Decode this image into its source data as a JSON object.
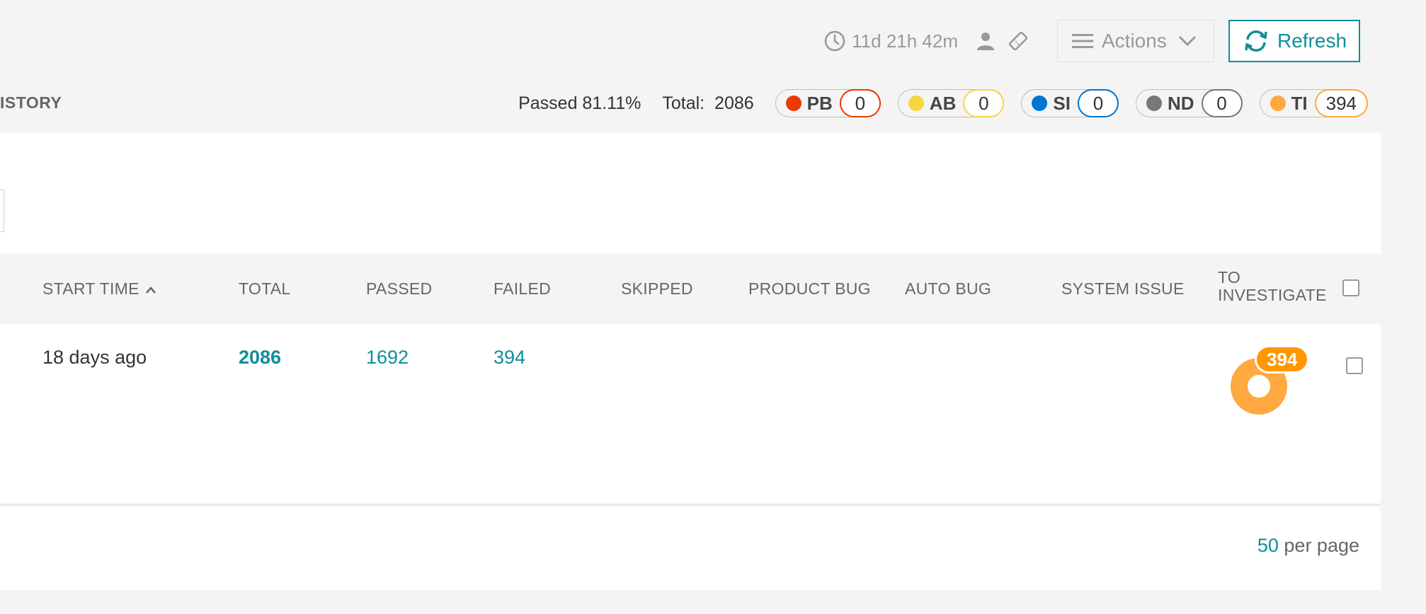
{
  "toolbar": {
    "duration": "11d 21h 42m",
    "actions_label": "Actions",
    "refresh_label": "Refresh"
  },
  "breadcrumb": {
    "partial_label": "ISTORY"
  },
  "statistics": {
    "passed": "Passed 81.11%",
    "total_label": "Total:",
    "total_value": "2086"
  },
  "defects": [
    {
      "abbr": "PB",
      "count": "0",
      "color": "#ec3900"
    },
    {
      "abbr": "AB",
      "count": "0",
      "color": "#f7d63e"
    },
    {
      "abbr": "SI",
      "count": "0",
      "color": "#0274d1"
    },
    {
      "abbr": "ND",
      "count": "0",
      "color": "#777777"
    },
    {
      "abbr": "TI",
      "count": "394",
      "color": "#ffa940"
    }
  ],
  "table": {
    "headers": {
      "start_time": "START TIME",
      "total": "TOTAL",
      "passed": "PASSED",
      "failed": "FAILED",
      "skipped": "SKIPPED",
      "product_bug": "PRODUCT BUG",
      "auto_bug": "AUTO BUG",
      "system_issue": "SYSTEM ISSUE",
      "to_investigate_1": "TO",
      "to_investigate_2": "INVESTIGATE"
    },
    "rows": [
      {
        "start_time": "18 days ago",
        "total": "2086",
        "passed": "1692",
        "failed": "394",
        "to_investigate": "394"
      }
    ]
  },
  "pagination": {
    "per_page_value": "50",
    "per_page_label": "per page"
  },
  "colors": {
    "accent": "#0f8e9b",
    "to_investigate": "#ffa940"
  }
}
